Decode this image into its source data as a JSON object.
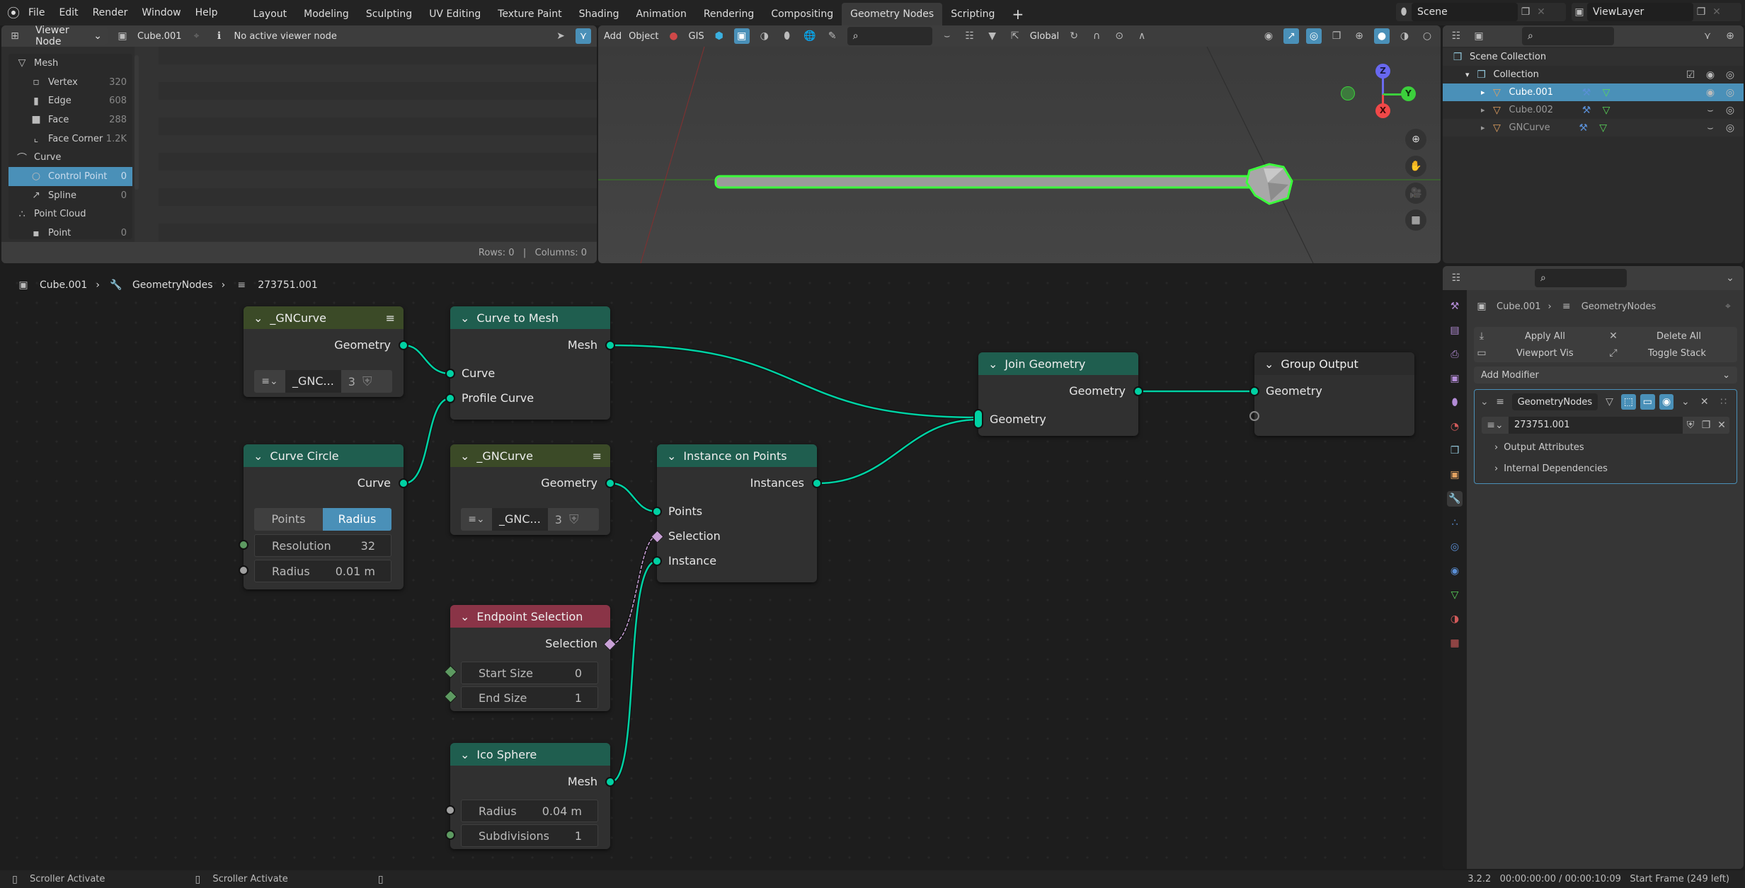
{
  "topbar": {
    "menus": [
      "File",
      "Edit",
      "Render",
      "Window",
      "Help"
    ],
    "workspaces": [
      "Layout",
      "Modeling",
      "Sculpting",
      "UV Editing",
      "Texture Paint",
      "Shading",
      "Animation",
      "Rendering",
      "Compositing",
      "Geometry Nodes",
      "Scripting"
    ],
    "active_workspace": "Geometry Nodes",
    "add_tab": "+",
    "scene": "Scene",
    "view_layer": "ViewLayer"
  },
  "spreadsheet": {
    "mode": "Viewer Node",
    "object": "Cube.001",
    "info": "No active viewer node",
    "domains": [
      {
        "label": "Mesh",
        "type": "group",
        "icon": "mesh-icon"
      },
      {
        "label": "Vertex",
        "count": "320",
        "icon": "vertex-icon"
      },
      {
        "label": "Edge",
        "count": "608",
        "icon": "edge-icon"
      },
      {
        "label": "Face",
        "count": "288",
        "icon": "face-icon"
      },
      {
        "label": "Face Corner",
        "count": "1.2K",
        "icon": "face-corner-icon"
      },
      {
        "label": "Curve",
        "type": "group",
        "icon": "curve-icon"
      },
      {
        "label": "Control Point",
        "count": "0",
        "icon": "control-point-icon",
        "selected": true
      },
      {
        "label": "Spline",
        "count": "0",
        "icon": "spline-icon"
      },
      {
        "label": "Point Cloud",
        "type": "group",
        "icon": "point-cloud-icon"
      },
      {
        "label": "Point",
        "count": "0",
        "icon": "point-icon"
      }
    ],
    "footer": "Rows: 0   |   Columns: 0"
  },
  "viewport": {
    "menus": [
      "Add",
      "Object",
      "GIS"
    ],
    "orientation": "Global",
    "gizmo": {
      "x": "X",
      "y": "Y",
      "z": "Z"
    }
  },
  "outliner": {
    "items": [
      {
        "label": "Scene Collection",
        "level": 0
      },
      {
        "label": "Collection",
        "level": 1
      },
      {
        "label": "Cube.001",
        "level": 2,
        "selected": true
      },
      {
        "label": "Cube.002",
        "level": 2
      },
      {
        "label": "GNCurve",
        "level": 2
      }
    ]
  },
  "node_editor": {
    "breadcrumb": [
      "Cube.001",
      "GeometryNodes",
      "273751.001"
    ],
    "nodes": {
      "gncurve1": {
        "title": "_GNCurve",
        "out": "Geometry",
        "datablock": "_GNC...",
        "users": "3"
      },
      "curve_to_mesh": {
        "title": "Curve to Mesh",
        "out": "Mesh",
        "in1": "Curve",
        "in2": "Profile Curve"
      },
      "curve_circle": {
        "title": "Curve Circle",
        "out": "Curve",
        "mode_a": "Points",
        "mode_b": "Radius",
        "resolution_label": "Resolution",
        "resolution": "32",
        "radius_label": "Radius",
        "radius": "0.01 m"
      },
      "gncurve2": {
        "title": "_GNCurve",
        "out": "Geometry",
        "datablock": "_GNC...",
        "users": "3"
      },
      "instance_on_points": {
        "title": "Instance on Points",
        "out": "Instances",
        "in1": "Points",
        "in2": "Selection",
        "in3": "Instance"
      },
      "endpoint_selection": {
        "title": "Endpoint Selection",
        "out": "Selection",
        "start_label": "Start Size",
        "start": "0",
        "end_label": "End Size",
        "end": "1"
      },
      "ico_sphere": {
        "title": "Ico Sphere",
        "out": "Mesh",
        "radius_label": "Radius",
        "radius": "0.04 m",
        "subdiv_label": "Subdivisions",
        "subdiv": "1"
      },
      "join_geometry": {
        "title": "Join Geometry",
        "out": "Geometry",
        "in1": "Geometry"
      },
      "group_output": {
        "title": "Group Output",
        "in1": "Geometry"
      }
    }
  },
  "properties": {
    "breadcrumb": [
      "Cube.001",
      "GeometryNodes"
    ],
    "apply_all": "Apply All",
    "delete_all": "Delete All",
    "viewport_vis": "Viewport Vis",
    "toggle_stack": "Toggle Stack",
    "add_modifier": "Add Modifier",
    "modifier_name": "GeometryNodes",
    "node_group": "273751.001",
    "panels": [
      "Output Attributes",
      "Internal Dependencies"
    ]
  },
  "status": {
    "left1": "Scroller Activate",
    "left2": "Scroller Activate",
    "right": "3.2.2   00:00:00:00 / 00:00:10:09   Start Frame (249 left)"
  },
  "colors": {
    "accent": "#4a90b8",
    "geometry_socket": "#00d1a3",
    "selection_outline": "#3cff3c"
  }
}
